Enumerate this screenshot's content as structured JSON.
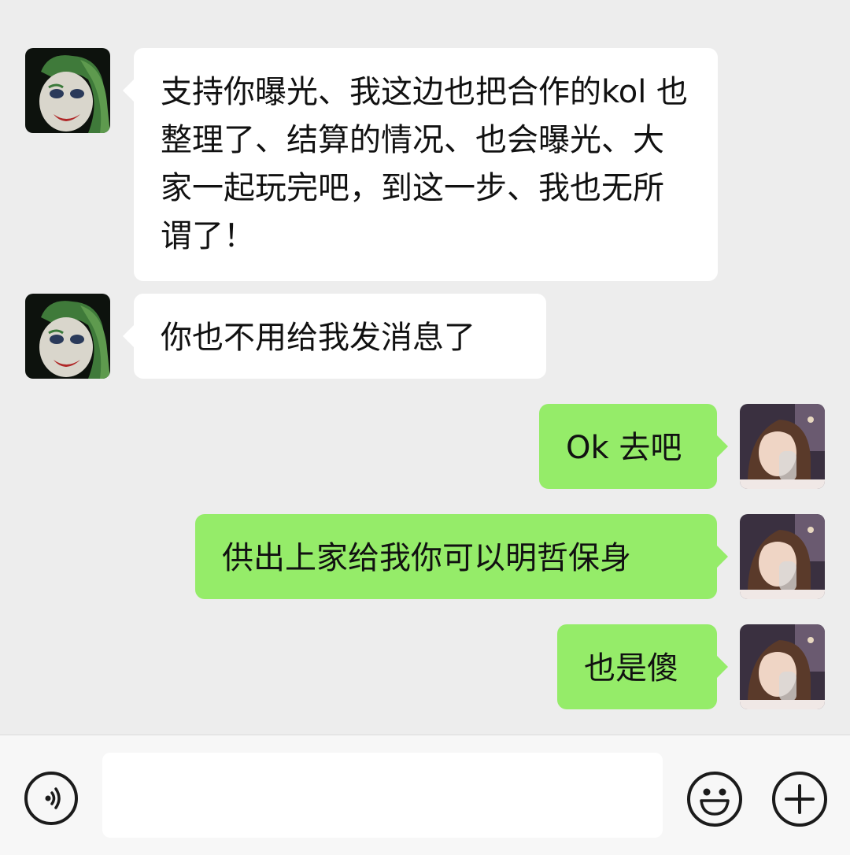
{
  "messages": [
    {
      "side": "in",
      "text": "支持你曝光、我这边也把合作的kol 也整理了、结算的情况、也会曝光、大家一起玩完吧，到这一步、我也无所谓了！",
      "avatar": "joker-avatar"
    },
    {
      "side": "in",
      "text": "你也不用给我发消息了",
      "avatar": "joker-avatar"
    },
    {
      "side": "out",
      "text": "Ok 去吧",
      "avatar": "self-avatar"
    },
    {
      "side": "out",
      "text": "供出上家给我你可以明哲保身",
      "avatar": "self-avatar"
    },
    {
      "side": "out",
      "text": "也是傻",
      "avatar": "self-avatar"
    }
  ],
  "input_bar": {
    "voice_icon": "voice-icon",
    "text_value": "",
    "emoji_icon": "emoji-icon",
    "plus_icon": "plus-icon"
  },
  "colors": {
    "background": "#ededed",
    "incoming_bubble": "#ffffff",
    "outgoing_bubble": "#95ec69",
    "input_bar": "#f7f7f7"
  }
}
